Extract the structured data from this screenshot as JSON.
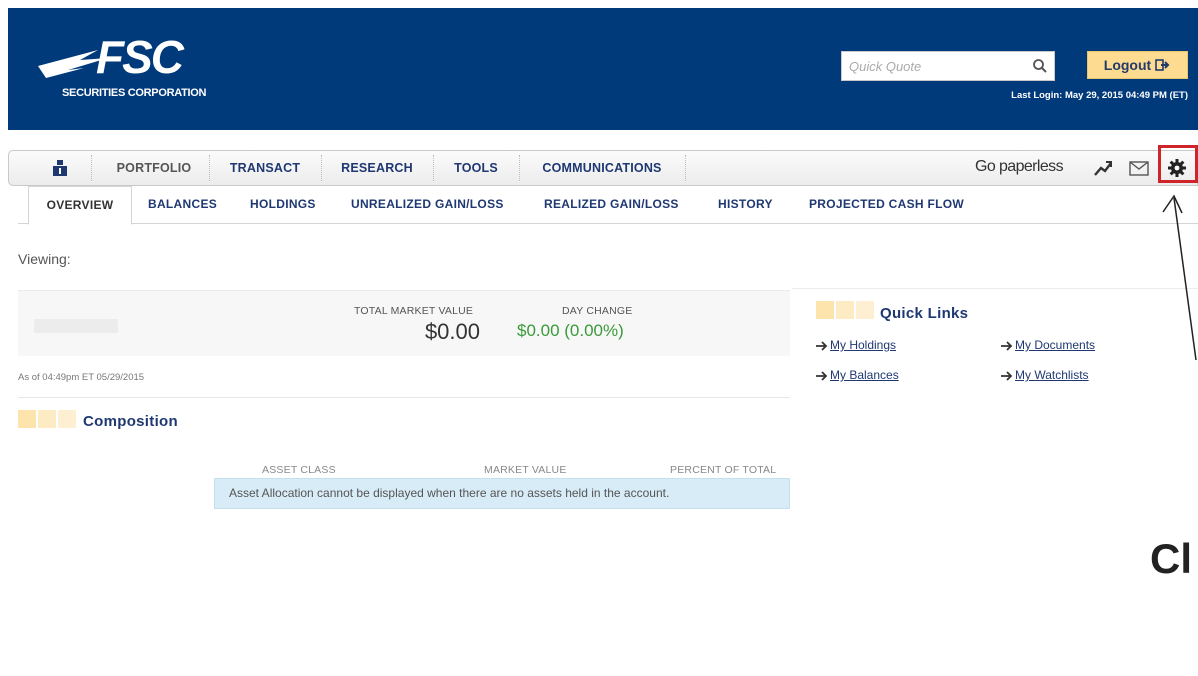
{
  "header": {
    "logo_text": "FSC",
    "logo_sub": "SECURITIES CORPORATION",
    "quick_quote_placeholder": "Quick Quote",
    "logout_label": "Logout",
    "last_login": "Last Login: May 29, 2015 04:49 PM (ET)"
  },
  "main_nav": {
    "items": [
      "PORTFOLIO",
      "TRANSACT",
      "RESEARCH",
      "TOOLS",
      "COMMUNICATIONS"
    ],
    "go_paperless": "Go paperless",
    "icons": [
      "user-icon",
      "chart-icon",
      "mail-icon",
      "gear-icon"
    ]
  },
  "sub_tabs": {
    "items": [
      "OVERVIEW",
      "BALANCES",
      "HOLDINGS",
      "UNREALIZED GAIN/LOSS",
      "REALIZED GAIN/LOSS",
      "HISTORY",
      "PROJECTED CASH FLOW"
    ],
    "active": "OVERVIEW"
  },
  "viewing_label": "Viewing:",
  "summary": {
    "total_market_value_label": "TOTAL MARKET VALUE",
    "total_market_value": "$0.00",
    "day_change_label": "DAY CHANGE",
    "day_change": "$0.00 (0.00%)",
    "as_of": "As of 04:49pm ET 05/29/2015"
  },
  "composition": {
    "title": "Composition",
    "columns": [
      "ASSET CLASS",
      "MARKET VALUE",
      "PERCENT OF TOTAL"
    ],
    "empty_message": "Asset Allocation cannot be displayed when there are no assets held in the account."
  },
  "quick_links": {
    "title": "Quick Links",
    "links": [
      "My Holdings",
      "My Documents",
      "My Balances",
      "My Watchlists"
    ]
  },
  "annotation": {
    "text": "Cl"
  },
  "colors": {
    "header_bg": "#003a7a",
    "nav_text": "#1f3872",
    "logout_bg": "#fddc91",
    "positive_green": "#3a9a3a",
    "highlight_red": "#d0242b"
  }
}
